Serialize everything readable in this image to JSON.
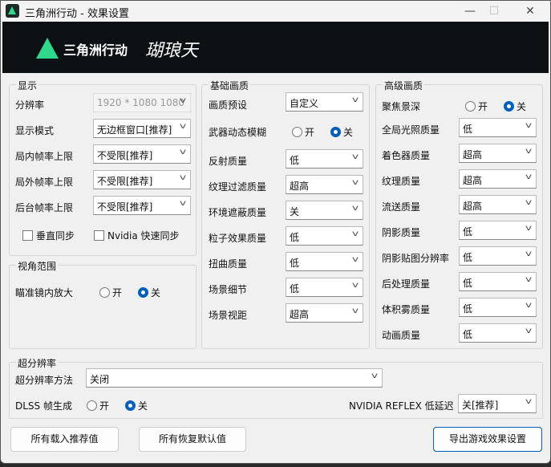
{
  "window": {
    "title": "三角洲行动 - 效果设置"
  },
  "banner": {
    "logo_text": "三角洲行动",
    "logo2_text": "瑚琅天"
  },
  "display": {
    "title": "显示",
    "rows": [
      {
        "label": "分辨率",
        "value": "1920 * 1080 1080",
        "disabled": true
      },
      {
        "label": "显示模式",
        "value": "无边框窗口[推荐]"
      },
      {
        "label": "局内帧率上限",
        "value": "不受限[推荐]"
      },
      {
        "label": "局外帧率上限",
        "value": "不受限[推荐]"
      },
      {
        "label": "后台帧率上限",
        "value": "不受限[推荐]"
      }
    ],
    "vsync": "垂直同步",
    "nvidia_sync": "Nvidia 快速同步"
  },
  "fov": {
    "title": "视角范围",
    "label": "瞄准镜内放大",
    "on": "开",
    "off": "关",
    "selected": "off"
  },
  "basic": {
    "title": "基础画质",
    "preset": {
      "label": "画质预设",
      "value": "自定义"
    },
    "motion_blur": {
      "label": "武器动态模糊",
      "on": "开",
      "off": "关",
      "selected": "off"
    },
    "rows": [
      {
        "label": "反射质量",
        "value": "低"
      },
      {
        "label": "纹理过滤质量",
        "value": "超高"
      },
      {
        "label": "环境遮蔽质量",
        "value": "关"
      },
      {
        "label": "粒子效果质量",
        "value": "低"
      },
      {
        "label": "扭曲质量",
        "value": "低"
      },
      {
        "label": "场景细节",
        "value": "低"
      },
      {
        "label": "场景视距",
        "value": "超高"
      }
    ]
  },
  "advanced": {
    "title": "高级画质",
    "dof": {
      "label": "聚焦景深",
      "on": "开",
      "off": "关",
      "selected": "off"
    },
    "rows": [
      {
        "label": "全局光照质量",
        "value": "低"
      },
      {
        "label": "着色器质量",
        "value": "超高"
      },
      {
        "label": "纹理质量",
        "value": "超高"
      },
      {
        "label": "流送质量",
        "value": "超高"
      },
      {
        "label": "阴影质量",
        "value": "低"
      },
      {
        "label": "阴影贴图分辨率",
        "value": "低"
      },
      {
        "label": "后处理质量",
        "value": "低"
      },
      {
        "label": "体积雾质量",
        "value": "低"
      },
      {
        "label": "动画质量",
        "value": "低"
      }
    ]
  },
  "superres": {
    "title": "超分辨率",
    "method_label": "超分辨率方法",
    "method_value": "关闭",
    "dlss_label": "DLSS 帧生成",
    "on": "开",
    "off": "关",
    "selected": "off",
    "reflex_label": "NVIDIA REFLEX 低延迟",
    "reflex_value": "关[推荐]"
  },
  "buttons": {
    "load_recommended": "所有载入推荐值",
    "restore_default": "所有恢复默认值",
    "export": "导出游戏效果设置"
  },
  "colors": {
    "accent": "#005fb8",
    "brand": "#2fd88a"
  }
}
